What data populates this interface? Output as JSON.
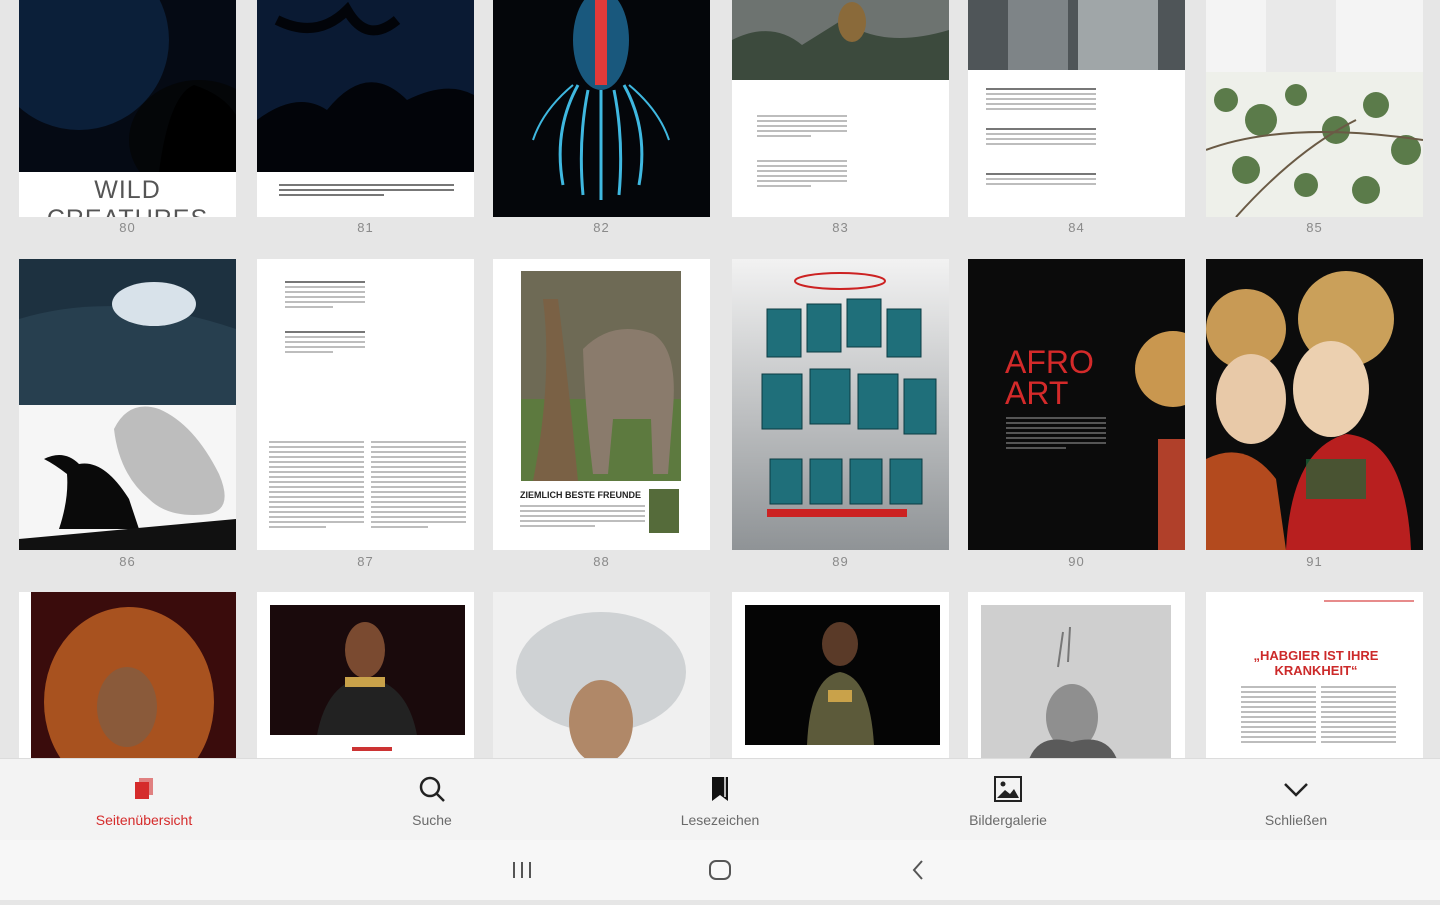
{
  "pages": {
    "row1": [
      "80",
      "81",
      "82",
      "83",
      "84",
      "85"
    ],
    "row2": [
      "86",
      "87",
      "88",
      "89",
      "90",
      "91"
    ]
  },
  "thumb_text": {
    "wild_creatures": "WILD CREATURES",
    "afro": "AFRO",
    "art": "ART",
    "freunde": "ZIEMLICH BESTE FREUNDE",
    "habgier": "„HABGIER IST IHRE KRANKHEIT“"
  },
  "toolbar": {
    "items": [
      {
        "label": "Seitenübersicht",
        "icon": "pages-overview-icon",
        "active": true
      },
      {
        "label": "Suche",
        "icon": "search-icon",
        "active": false
      },
      {
        "label": "Lesezeichen",
        "icon": "bookmark-icon",
        "active": false
      },
      {
        "label": "Bildergalerie",
        "icon": "image-gallery-icon",
        "active": false
      },
      {
        "label": "Schließen",
        "icon": "chevron-down-icon",
        "active": false
      }
    ]
  },
  "system_nav": [
    "recent-apps-icon",
    "home-icon",
    "back-icon"
  ],
  "colors": {
    "accent": "#d52b2b",
    "toolbar_bg": "#f3f3f3",
    "grid_bg": "#e6e6e6"
  }
}
